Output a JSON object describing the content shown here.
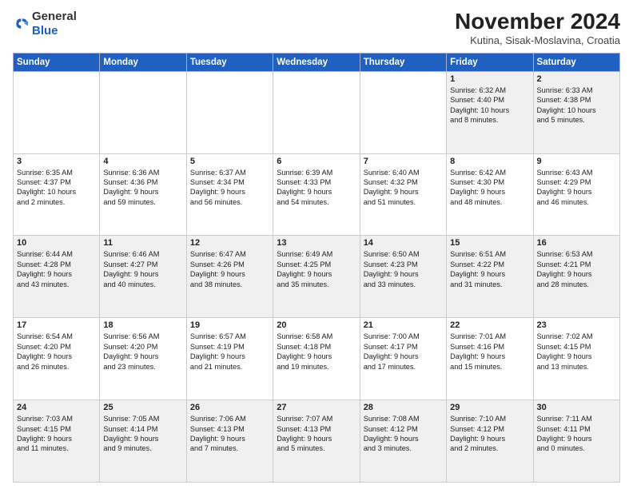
{
  "logo": {
    "general": "General",
    "blue": "Blue"
  },
  "header": {
    "title": "November 2024",
    "location": "Kutina, Sisak-Moslavina, Croatia"
  },
  "weekdays": [
    "Sunday",
    "Monday",
    "Tuesday",
    "Wednesday",
    "Thursday",
    "Friday",
    "Saturday"
  ],
  "weeks": [
    [
      {
        "day": "",
        "info": ""
      },
      {
        "day": "",
        "info": ""
      },
      {
        "day": "",
        "info": ""
      },
      {
        "day": "",
        "info": ""
      },
      {
        "day": "",
        "info": ""
      },
      {
        "day": "1",
        "info": "Sunrise: 6:32 AM\nSunset: 4:40 PM\nDaylight: 10 hours\nand 8 minutes."
      },
      {
        "day": "2",
        "info": "Sunrise: 6:33 AM\nSunset: 4:38 PM\nDaylight: 10 hours\nand 5 minutes."
      }
    ],
    [
      {
        "day": "3",
        "info": "Sunrise: 6:35 AM\nSunset: 4:37 PM\nDaylight: 10 hours\nand 2 minutes."
      },
      {
        "day": "4",
        "info": "Sunrise: 6:36 AM\nSunset: 4:36 PM\nDaylight: 9 hours\nand 59 minutes."
      },
      {
        "day": "5",
        "info": "Sunrise: 6:37 AM\nSunset: 4:34 PM\nDaylight: 9 hours\nand 56 minutes."
      },
      {
        "day": "6",
        "info": "Sunrise: 6:39 AM\nSunset: 4:33 PM\nDaylight: 9 hours\nand 54 minutes."
      },
      {
        "day": "7",
        "info": "Sunrise: 6:40 AM\nSunset: 4:32 PM\nDaylight: 9 hours\nand 51 minutes."
      },
      {
        "day": "8",
        "info": "Sunrise: 6:42 AM\nSunset: 4:30 PM\nDaylight: 9 hours\nand 48 minutes."
      },
      {
        "day": "9",
        "info": "Sunrise: 6:43 AM\nSunset: 4:29 PM\nDaylight: 9 hours\nand 46 minutes."
      }
    ],
    [
      {
        "day": "10",
        "info": "Sunrise: 6:44 AM\nSunset: 4:28 PM\nDaylight: 9 hours\nand 43 minutes."
      },
      {
        "day": "11",
        "info": "Sunrise: 6:46 AM\nSunset: 4:27 PM\nDaylight: 9 hours\nand 40 minutes."
      },
      {
        "day": "12",
        "info": "Sunrise: 6:47 AM\nSunset: 4:26 PM\nDaylight: 9 hours\nand 38 minutes."
      },
      {
        "day": "13",
        "info": "Sunrise: 6:49 AM\nSunset: 4:25 PM\nDaylight: 9 hours\nand 35 minutes."
      },
      {
        "day": "14",
        "info": "Sunrise: 6:50 AM\nSunset: 4:23 PM\nDaylight: 9 hours\nand 33 minutes."
      },
      {
        "day": "15",
        "info": "Sunrise: 6:51 AM\nSunset: 4:22 PM\nDaylight: 9 hours\nand 31 minutes."
      },
      {
        "day": "16",
        "info": "Sunrise: 6:53 AM\nSunset: 4:21 PM\nDaylight: 9 hours\nand 28 minutes."
      }
    ],
    [
      {
        "day": "17",
        "info": "Sunrise: 6:54 AM\nSunset: 4:20 PM\nDaylight: 9 hours\nand 26 minutes."
      },
      {
        "day": "18",
        "info": "Sunrise: 6:56 AM\nSunset: 4:20 PM\nDaylight: 9 hours\nand 23 minutes."
      },
      {
        "day": "19",
        "info": "Sunrise: 6:57 AM\nSunset: 4:19 PM\nDaylight: 9 hours\nand 21 minutes."
      },
      {
        "day": "20",
        "info": "Sunrise: 6:58 AM\nSunset: 4:18 PM\nDaylight: 9 hours\nand 19 minutes."
      },
      {
        "day": "21",
        "info": "Sunrise: 7:00 AM\nSunset: 4:17 PM\nDaylight: 9 hours\nand 17 minutes."
      },
      {
        "day": "22",
        "info": "Sunrise: 7:01 AM\nSunset: 4:16 PM\nDaylight: 9 hours\nand 15 minutes."
      },
      {
        "day": "23",
        "info": "Sunrise: 7:02 AM\nSunset: 4:15 PM\nDaylight: 9 hours\nand 13 minutes."
      }
    ],
    [
      {
        "day": "24",
        "info": "Sunrise: 7:03 AM\nSunset: 4:15 PM\nDaylight: 9 hours\nand 11 minutes."
      },
      {
        "day": "25",
        "info": "Sunrise: 7:05 AM\nSunset: 4:14 PM\nDaylight: 9 hours\nand 9 minutes."
      },
      {
        "day": "26",
        "info": "Sunrise: 7:06 AM\nSunset: 4:13 PM\nDaylight: 9 hours\nand 7 minutes."
      },
      {
        "day": "27",
        "info": "Sunrise: 7:07 AM\nSunset: 4:13 PM\nDaylight: 9 hours\nand 5 minutes."
      },
      {
        "day": "28",
        "info": "Sunrise: 7:08 AM\nSunset: 4:12 PM\nDaylight: 9 hours\nand 3 minutes."
      },
      {
        "day": "29",
        "info": "Sunrise: 7:10 AM\nSunset: 4:12 PM\nDaylight: 9 hours\nand 2 minutes."
      },
      {
        "day": "30",
        "info": "Sunrise: 7:11 AM\nSunset: 4:11 PM\nDaylight: 9 hours\nand 0 minutes."
      }
    ]
  ]
}
